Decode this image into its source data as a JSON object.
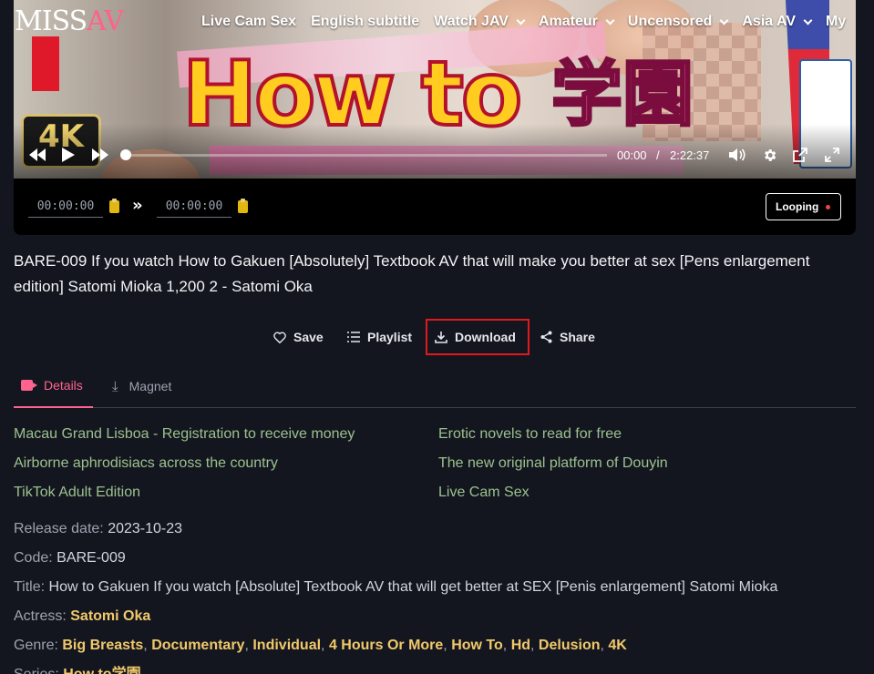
{
  "site": {
    "logo_part1": "MISS",
    "logo_part2": "AV"
  },
  "nav": [
    {
      "label": "Live Cam Sex",
      "has_dropdown": false
    },
    {
      "label": "English subtitle",
      "has_dropdown": false
    },
    {
      "label": "Watch JAV",
      "has_dropdown": true
    },
    {
      "label": "Amateur",
      "has_dropdown": true
    },
    {
      "label": "Uncensored",
      "has_dropdown": true
    },
    {
      "label": "Asia AV",
      "has_dropdown": true
    },
    {
      "label": "My",
      "has_dropdown": false
    }
  ],
  "player": {
    "current_time": "00:00",
    "separator": "/",
    "duration": "2:22:37",
    "progress": 0,
    "loop_start": "00:00:00",
    "loop_end": "00:00:00",
    "looping_label": "Looping",
    "thumbnail": {
      "title_text": "How to",
      "title_kanji": "学園",
      "badge_4k": "4K"
    }
  },
  "video": {
    "title": "BARE-009 If you watch How to Gakuen [Absolutely] Textbook AV that will make you better at sex [Pens enlargement edition] Satomi Mioka 1,200 2 - Satomi Oka"
  },
  "actions": {
    "save": "Save",
    "playlist": "Playlist",
    "download": "Download",
    "share": "Share"
  },
  "tabs": {
    "details": "Details",
    "magnet": "Magnet"
  },
  "ad_links": [
    "Macau Grand Lisboa - Registration to receive money",
    "Erotic novels to read for free",
    "Airborne aphrodisiacs across the country",
    "The new original platform of Douyin",
    "TikTok Adult Edition",
    "Live Cam Sex"
  ],
  "details": {
    "release_label": "Release date:",
    "release_value": "2023-10-23",
    "code_label": "Code:",
    "code_value": "BARE-009",
    "title_label": "Title:",
    "title_value": "How to Gakuen If you watch [Absolute] Textbook AV that will get better at SEX [Penis enlargement] Satomi Mioka",
    "actress_label": "Actress:",
    "actress_value": "Satomi Oka",
    "genre_label": "Genre:",
    "genres": [
      "Big Breasts",
      "Documentary",
      "Individual",
      "4 Hours Or More",
      "How To",
      "Hd",
      "Delusion",
      "4K"
    ],
    "series_label": "Series:",
    "series_value": "How to学園"
  },
  "colors": {
    "background": "#14161f",
    "accent": "#fe628e",
    "link_gold": "#f1c96b",
    "ad_green": "#9bc18f",
    "highlight_red": "#e0191e"
  }
}
